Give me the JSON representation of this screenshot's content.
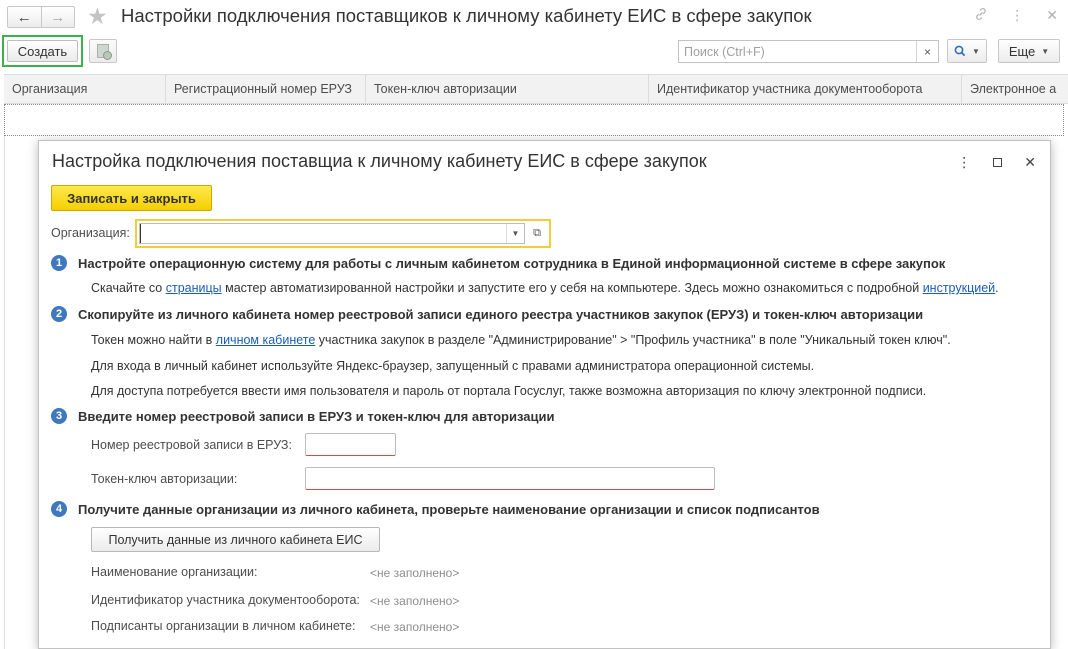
{
  "window": {
    "title": "Настройки подключения поставщиков к личному кабинету ЕИС в сфере закупок"
  },
  "toolbar": {
    "create_label": "Создать",
    "search_placeholder": "Поиск (Ctrl+F)",
    "search_clear": "×",
    "more_label": "Еще"
  },
  "table": {
    "columns": [
      "Организация",
      "Регистрационный номер ЕРУЗ",
      "Токен-ключ авторизации",
      "Идентификатор участника документооборота",
      "Электронное а"
    ]
  },
  "dialog": {
    "title": "Настройка подключения поставщиа к личному кабинету ЕИС в сфере закупок",
    "save_close_label": "Записать и закрыть",
    "organization_label": "Организация:",
    "organization_value": "",
    "steps": [
      {
        "number": "1",
        "title": "Настройте операционную систему для работы с личным кабинетом сотрудника в Единой информационной системе в сфере закупок",
        "text_before": "Скачайте со ",
        "link1": "страницы",
        "text_middle": " мастер автоматизированной настройки и запустите его у себя на компьютере. Здесь можно ознакомиться с подробной ",
        "link2": "инструкцией",
        "text_after": "."
      },
      {
        "number": "2",
        "title": "Скопируйте из личного кабинета номер реестровой записи единого реестра участников закупок (ЕРУЗ) и токен-ключ авторизации",
        "line1_before": "Токен можно найти в ",
        "line1_link": "личном кабинете",
        "line1_after": " участника закупок в разделе \"Администрирование\" > \"Профиль участника\" в поле \"Уникальный токен ключ\".",
        "line2": "Для входа в личный кабинет используйте Яндекс-браузер, запущенный с правами администратора операционной системы.",
        "line3": "Для доступа потребуется ввести имя пользователя и пароль от портала Госуслуг, также возможна авторизация по ключу электронной подписи."
      },
      {
        "number": "3",
        "title": "Введите номер реестровой записи в ЕРУЗ и токен-ключ для авторизации",
        "eruz_label": "Номер реестровой записи в ЕРУЗ:",
        "eruz_value": "",
        "token_label": "Токен-ключ авторизации:",
        "token_value": ""
      },
      {
        "number": "4",
        "title": "Получите данные организации из личного кабинета, проверьте наименование организации и список подписантов",
        "button_label": "Получить данные из личного кабинета ЕИС",
        "fields": [
          {
            "label": "Наименование организации:",
            "value": "<не заполнено>"
          },
          {
            "label": "Идентификатор участника документооборота:",
            "value": "<не заполнено>"
          },
          {
            "label": "Подписанты организации в личном кабинете:",
            "value": "<не заполнено>"
          }
        ]
      }
    ]
  },
  "icons": {
    "back": "←",
    "forward": "→",
    "favorite": "★",
    "link": "🔗",
    "kebab": "⋮",
    "close": "✕",
    "search": "🔍",
    "caret": "▼",
    "open": "⧉"
  },
  "colors": {
    "accent_blue": "#3f78bf",
    "link_blue": "#1b5bbc",
    "save_yellow": "#f5cf00",
    "create_highlight": "#3cb04d",
    "required_red": "#e04646"
  }
}
